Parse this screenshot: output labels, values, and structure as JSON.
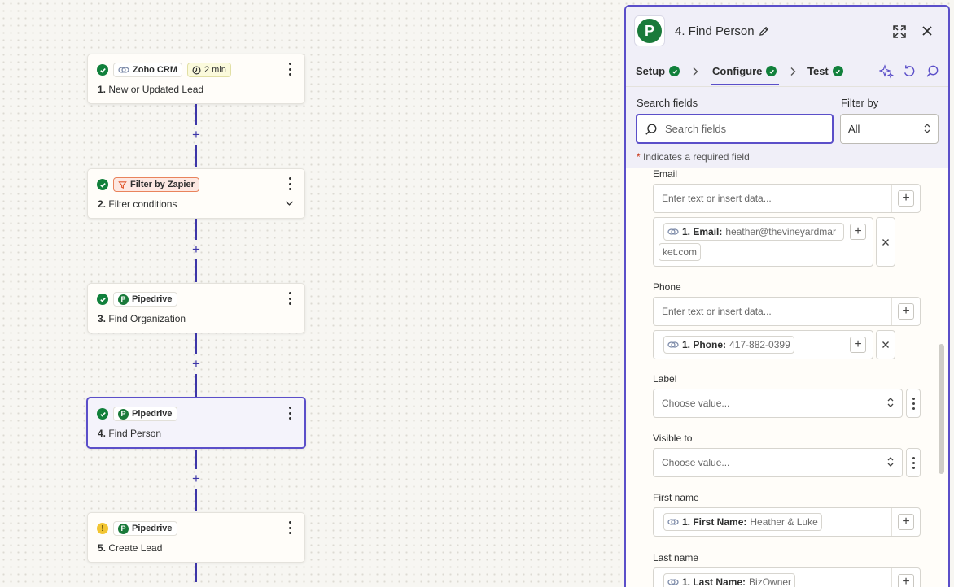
{
  "canvas": {
    "steps": [
      {
        "status": "ok",
        "app": "Zoho CRM",
        "app_icon": "zoho-link-icon",
        "time": "2 min",
        "number": "1.",
        "title": "New or Updated Lead"
      },
      {
        "status": "ok",
        "app": "Filter by Zapier",
        "app_icon": "filter-icon",
        "number": "2.",
        "title": "Filter conditions"
      },
      {
        "status": "ok",
        "app": "Pipedrive",
        "app_icon": "pipedrive-icon",
        "number": "3.",
        "title": "Find Organization"
      },
      {
        "status": "ok",
        "app": "Pipedrive",
        "app_icon": "pipedrive-icon",
        "number": "4.",
        "title": "Find Person",
        "selected": true
      },
      {
        "status": "warning",
        "app": "Pipedrive",
        "app_icon": "pipedrive-icon",
        "number": "5.",
        "title": "Create Lead"
      }
    ]
  },
  "panel": {
    "title": "4. Find Person",
    "tabs": [
      "Setup",
      "Configure",
      "Test"
    ],
    "active_tab": "Configure",
    "search_label": "Search fields",
    "search_placeholder": "Search fields",
    "filter_label": "Filter by",
    "filter_value": "All",
    "required_note": "Indicates a required field",
    "required_star": "*",
    "fields": {
      "email": {
        "label": "Email",
        "placeholder": "Enter text or insert data...",
        "mapped_key": "1. Email:",
        "mapped_value_a": "heather@thevineyardmar",
        "mapped_value_b": "ket.com"
      },
      "phone": {
        "label": "Phone",
        "placeholder": "Enter text or insert data...",
        "mapped_key": "1. Phone:",
        "mapped_value": "417-882-0399"
      },
      "label": {
        "label": "Label",
        "placeholder": "Choose value..."
      },
      "visible_to": {
        "label": "Visible to",
        "placeholder": "Choose value..."
      },
      "first_name": {
        "label": "First name",
        "mapped_key": "1. First Name:",
        "mapped_value": "Heather & Luke"
      },
      "last_name": {
        "label": "Last name",
        "mapped_key": "1. Last Name:",
        "mapped_value": "BizOwner"
      }
    }
  },
  "colors": {
    "accent": "#5b4fc9",
    "success": "#11803b",
    "warning": "#f2c531",
    "pipedrive": "#1a7a3a"
  }
}
